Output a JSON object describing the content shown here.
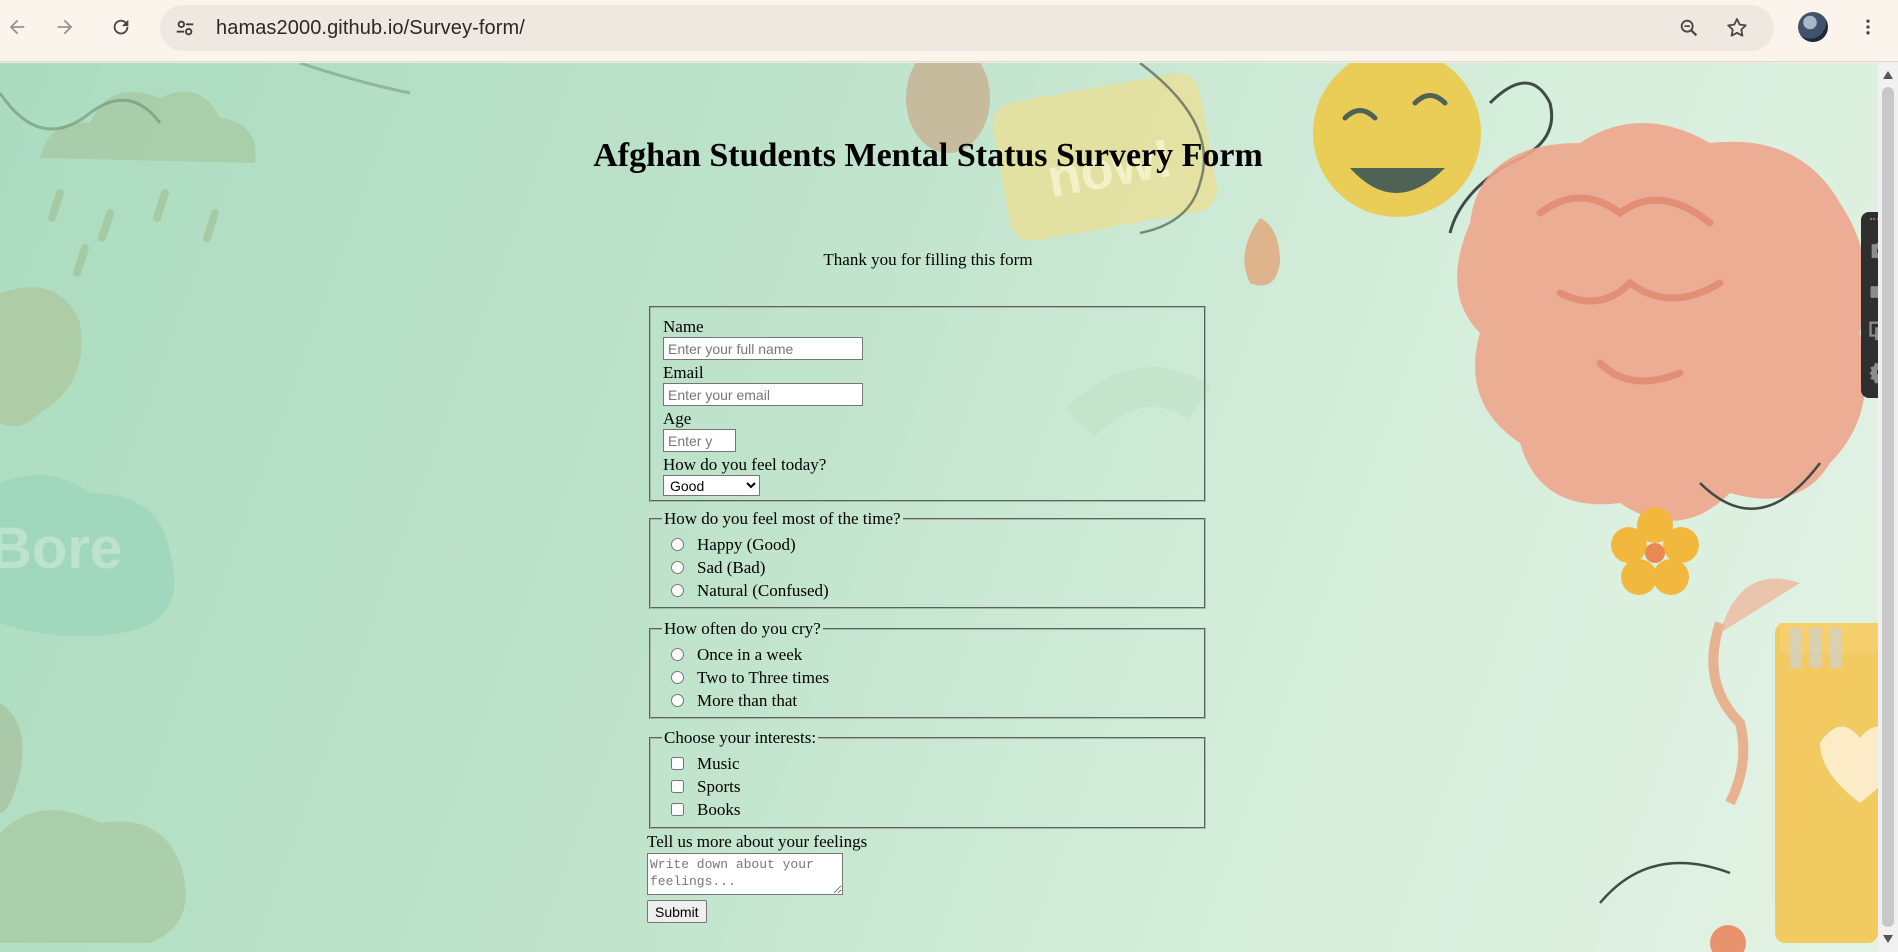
{
  "browser": {
    "url": "hamas2000.github.io/Survey-form/"
  },
  "page": {
    "title": "Afghan Students Mental Status Survery Form",
    "subtitle": "Thank you for filling this form",
    "name_label": "Name",
    "name_placeholder": "Enter your full name",
    "email_label": "Email",
    "email_placeholder": "Enter your email",
    "age_label": "Age",
    "age_placeholder": "Enter y",
    "feel_today_label": "How do you feel today?",
    "feel_today_selected": "Good",
    "mood_group": {
      "legend": "How do you feel most of the time?",
      "options": [
        "Happy (Good)",
        "Sad (Bad)",
        "Natural (Confused)"
      ]
    },
    "cry_group": {
      "legend": "How often do you cry?",
      "options": [
        "Once in a week",
        "Two to Three times",
        "More than that"
      ]
    },
    "interests_group": {
      "legend": "Choose your interests:",
      "options": [
        "Music",
        "Sports",
        "Books"
      ]
    },
    "feelings_label": "Tell us more about your feelings",
    "feelings_placeholder": "Write down about your feelings...",
    "submit_label": "Submit"
  }
}
